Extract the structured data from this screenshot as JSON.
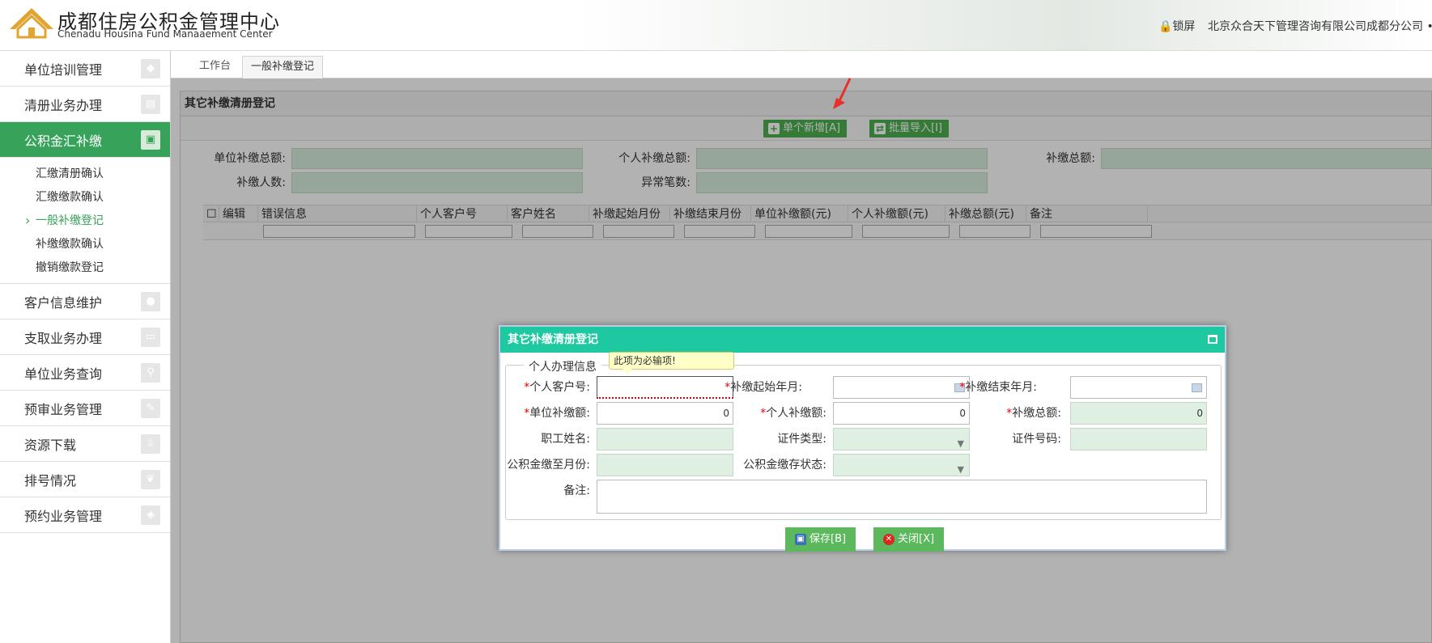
{
  "header": {
    "title": "成都住房公积金管理中心",
    "subtitle": "Chenadu  Housina Fund Manaaement Center",
    "lock_label": "锁屏",
    "company": "北京众合天下管理咨询有限公司成都分公司 •"
  },
  "sidebar": {
    "items": [
      {
        "label": "单位培训管理",
        "icon": "chat-icon"
      },
      {
        "label": "清册业务办理",
        "icon": "book-icon"
      },
      {
        "label": "公积金汇补缴",
        "icon": "money-icon"
      },
      {
        "label": "客户信息维护",
        "icon": "user-icon"
      },
      {
        "label": "支取业务办理",
        "icon": "card-icon"
      },
      {
        "label": "单位业务查询",
        "icon": "search-icon"
      },
      {
        "label": "预审业务管理",
        "icon": "edit-icon"
      },
      {
        "label": "资源下载",
        "icon": "download-icon"
      },
      {
        "label": "排号情况",
        "icon": "leaf-icon"
      },
      {
        "label": "预约业务管理",
        "icon": "tag-icon"
      }
    ],
    "sub_items": [
      "汇缴清册确认",
      "汇缴缴款确认",
      "一般补缴登记",
      "补缴缴款确认",
      "撤销缴款登记"
    ]
  },
  "tabs": [
    "工作台",
    "一般补缴登记"
  ],
  "panel": {
    "title": "其它补缴清册登记",
    "btn_single_add": "单个新增[A]",
    "btn_batch_import": "批量导入[I]",
    "summary": {
      "unit_total_label": "单位补缴总额:",
      "person_total_label": "个人补缴总额:",
      "total_label": "补缴总额:",
      "count_label": "补缴人数:",
      "abnormal_label": "异常笔数:"
    },
    "grid_columns": [
      "编辑",
      "错误信息",
      "个人客户号",
      "客户姓名",
      "补缴起始月份",
      "补缴结束月份",
      "单位补缴额(元)",
      "个人补缴额(元)",
      "补缴总额(元)",
      "备注"
    ]
  },
  "dialog": {
    "title": "其它补缴清册登记",
    "legend": "个人办理信息",
    "tooltip": "此项为必输项!",
    "fields": {
      "customer_no_label": "个人客户号:",
      "start_month_label": "补缴起始年月:",
      "end_month_label": "补缴结束年月:",
      "unit_amount_label": "单位补缴额:",
      "unit_amount_value": "0",
      "person_amount_label": "个人补缴额:",
      "person_amount_value": "0",
      "total_amount_label": "补缴总额:",
      "total_amount_value": "0",
      "name_label": "职工姓名:",
      "id_type_label": "证件类型:",
      "id_no_label": "证件号码:",
      "paid_to_label": "公积金缴至月份:",
      "status_label": "公积金缴存状态:",
      "remark_label": "备注:"
    },
    "save_label": "保存[B]",
    "close_label": "关闭[X]"
  },
  "colors": {
    "accent_green": "#37a35a",
    "dialog_header": "#1ec8a0",
    "readonly_fill": "#dff0e2",
    "required": "#e00000"
  }
}
